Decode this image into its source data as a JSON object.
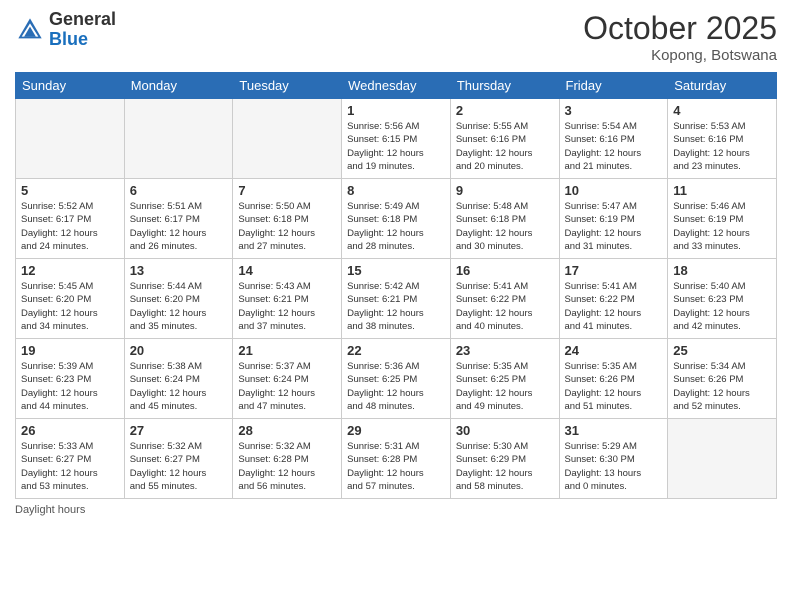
{
  "header": {
    "logo_general": "General",
    "logo_blue": "Blue",
    "month": "October 2025",
    "location": "Kopong, Botswana"
  },
  "weekdays": [
    "Sunday",
    "Monday",
    "Tuesday",
    "Wednesday",
    "Thursday",
    "Friday",
    "Saturday"
  ],
  "weeks": [
    [
      {
        "day": "",
        "info": ""
      },
      {
        "day": "",
        "info": ""
      },
      {
        "day": "",
        "info": ""
      },
      {
        "day": "1",
        "info": "Sunrise: 5:56 AM\nSunset: 6:15 PM\nDaylight: 12 hours\nand 19 minutes."
      },
      {
        "day": "2",
        "info": "Sunrise: 5:55 AM\nSunset: 6:16 PM\nDaylight: 12 hours\nand 20 minutes."
      },
      {
        "day": "3",
        "info": "Sunrise: 5:54 AM\nSunset: 6:16 PM\nDaylight: 12 hours\nand 21 minutes."
      },
      {
        "day": "4",
        "info": "Sunrise: 5:53 AM\nSunset: 6:16 PM\nDaylight: 12 hours\nand 23 minutes."
      }
    ],
    [
      {
        "day": "5",
        "info": "Sunrise: 5:52 AM\nSunset: 6:17 PM\nDaylight: 12 hours\nand 24 minutes."
      },
      {
        "day": "6",
        "info": "Sunrise: 5:51 AM\nSunset: 6:17 PM\nDaylight: 12 hours\nand 26 minutes."
      },
      {
        "day": "7",
        "info": "Sunrise: 5:50 AM\nSunset: 6:18 PM\nDaylight: 12 hours\nand 27 minutes."
      },
      {
        "day": "8",
        "info": "Sunrise: 5:49 AM\nSunset: 6:18 PM\nDaylight: 12 hours\nand 28 minutes."
      },
      {
        "day": "9",
        "info": "Sunrise: 5:48 AM\nSunset: 6:18 PM\nDaylight: 12 hours\nand 30 minutes."
      },
      {
        "day": "10",
        "info": "Sunrise: 5:47 AM\nSunset: 6:19 PM\nDaylight: 12 hours\nand 31 minutes."
      },
      {
        "day": "11",
        "info": "Sunrise: 5:46 AM\nSunset: 6:19 PM\nDaylight: 12 hours\nand 33 minutes."
      }
    ],
    [
      {
        "day": "12",
        "info": "Sunrise: 5:45 AM\nSunset: 6:20 PM\nDaylight: 12 hours\nand 34 minutes."
      },
      {
        "day": "13",
        "info": "Sunrise: 5:44 AM\nSunset: 6:20 PM\nDaylight: 12 hours\nand 35 minutes."
      },
      {
        "day": "14",
        "info": "Sunrise: 5:43 AM\nSunset: 6:21 PM\nDaylight: 12 hours\nand 37 minutes."
      },
      {
        "day": "15",
        "info": "Sunrise: 5:42 AM\nSunset: 6:21 PM\nDaylight: 12 hours\nand 38 minutes."
      },
      {
        "day": "16",
        "info": "Sunrise: 5:41 AM\nSunset: 6:22 PM\nDaylight: 12 hours\nand 40 minutes."
      },
      {
        "day": "17",
        "info": "Sunrise: 5:41 AM\nSunset: 6:22 PM\nDaylight: 12 hours\nand 41 minutes."
      },
      {
        "day": "18",
        "info": "Sunrise: 5:40 AM\nSunset: 6:23 PM\nDaylight: 12 hours\nand 42 minutes."
      }
    ],
    [
      {
        "day": "19",
        "info": "Sunrise: 5:39 AM\nSunset: 6:23 PM\nDaylight: 12 hours\nand 44 minutes."
      },
      {
        "day": "20",
        "info": "Sunrise: 5:38 AM\nSunset: 6:24 PM\nDaylight: 12 hours\nand 45 minutes."
      },
      {
        "day": "21",
        "info": "Sunrise: 5:37 AM\nSunset: 6:24 PM\nDaylight: 12 hours\nand 47 minutes."
      },
      {
        "day": "22",
        "info": "Sunrise: 5:36 AM\nSunset: 6:25 PM\nDaylight: 12 hours\nand 48 minutes."
      },
      {
        "day": "23",
        "info": "Sunrise: 5:35 AM\nSunset: 6:25 PM\nDaylight: 12 hours\nand 49 minutes."
      },
      {
        "day": "24",
        "info": "Sunrise: 5:35 AM\nSunset: 6:26 PM\nDaylight: 12 hours\nand 51 minutes."
      },
      {
        "day": "25",
        "info": "Sunrise: 5:34 AM\nSunset: 6:26 PM\nDaylight: 12 hours\nand 52 minutes."
      }
    ],
    [
      {
        "day": "26",
        "info": "Sunrise: 5:33 AM\nSunset: 6:27 PM\nDaylight: 12 hours\nand 53 minutes."
      },
      {
        "day": "27",
        "info": "Sunrise: 5:32 AM\nSunset: 6:27 PM\nDaylight: 12 hours\nand 55 minutes."
      },
      {
        "day": "28",
        "info": "Sunrise: 5:32 AM\nSunset: 6:28 PM\nDaylight: 12 hours\nand 56 minutes."
      },
      {
        "day": "29",
        "info": "Sunrise: 5:31 AM\nSunset: 6:28 PM\nDaylight: 12 hours\nand 57 minutes."
      },
      {
        "day": "30",
        "info": "Sunrise: 5:30 AM\nSunset: 6:29 PM\nDaylight: 12 hours\nand 58 minutes."
      },
      {
        "day": "31",
        "info": "Sunrise: 5:29 AM\nSunset: 6:30 PM\nDaylight: 13 hours\nand 0 minutes."
      },
      {
        "day": "",
        "info": ""
      }
    ]
  ],
  "footer": {
    "daylight_label": "Daylight hours"
  }
}
